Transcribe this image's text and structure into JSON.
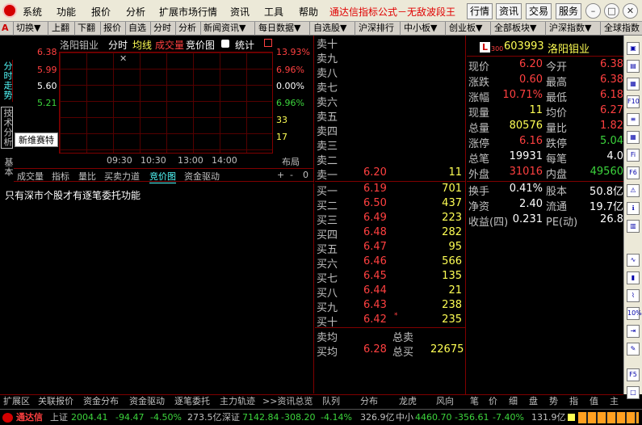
{
  "menubar": {
    "items": [
      "系统",
      "功能",
      "报价",
      "分析",
      "扩展市场行情",
      "资讯",
      "工具",
      "帮助"
    ],
    "title": "通达信指标公式－无敌波段王",
    "buttons": [
      "行情",
      "资讯",
      "交易",
      "服务"
    ]
  },
  "toolbar": {
    "items": [
      "A",
      "切换▼",
      "上翻",
      "下翻",
      "报价",
      "自选",
      "分时",
      "分析",
      "新闻资讯▼",
      "每日数据▼",
      "自选股▼",
      "沪深排行",
      "中小板▼",
      "创业板▼",
      "全部板块▼",
      "沪深指数▼",
      "全球指数"
    ]
  },
  "vtabs": [
    "分时走势",
    "技术分析",
    "基本"
  ],
  "chart": {
    "stock_name": "洛阳钼业",
    "tabs": [
      "分时",
      "均线",
      "成交量",
      "竞价图",
      "统计"
    ],
    "prices_left": [
      "6.38",
      "5.99",
      "5.60",
      "5.21"
    ],
    "pct_right": [
      "13.93%",
      "6.96%",
      "0.00%",
      "6.96%"
    ],
    "vol_right": [
      "33",
      "17"
    ],
    "times": [
      "09:30",
      "10:30",
      "13:00",
      "14:00"
    ],
    "layout_label": "布局",
    "new_label": "新维赛特",
    "subtabs": [
      "成交量",
      "指标",
      "量比",
      "买卖力道",
      "竞价图",
      "资金驱动"
    ],
    "controls": [
      "+",
      "-",
      "0"
    ]
  },
  "message": "只有深市个股才有逐笔委托功能",
  "quotes": {
    "sell_empty": [
      "卖十",
      "卖九",
      "卖八",
      "卖七",
      "卖六",
      "卖五",
      "卖四",
      "卖三",
      "卖二"
    ],
    "sell1": {
      "label": "卖一",
      "price": "6.20",
      "vol": "11"
    },
    "buy": [
      {
        "label": "买一",
        "price": "6.19",
        "vol": "701"
      },
      {
        "label": "买二",
        "price": "6.50",
        "vol": "437"
      },
      {
        "label": "买三",
        "price": "6.49",
        "vol": "223"
      },
      {
        "label": "买四",
        "price": "6.48",
        "vol": "282"
      },
      {
        "label": "买五",
        "price": "6.47",
        "vol": "95"
      },
      {
        "label": "买六",
        "price": "6.46",
        "vol": "566"
      },
      {
        "label": "买七",
        "price": "6.45",
        "vol": "135"
      },
      {
        "label": "买八",
        "price": "6.44",
        "vol": "21"
      },
      {
        "label": "买九",
        "price": "6.43",
        "vol": "238"
      },
      {
        "label": "买十",
        "price": "6.42",
        "vol": "235",
        "mark": "*"
      }
    ],
    "sell_avg_label": "卖均",
    "sell_total_label": "总卖",
    "buy_avg_label": "买均",
    "buy_avg": "6.28",
    "buy_total_label": "总买",
    "buy_total": "22675"
  },
  "stockinfo": {
    "badge": "L",
    "market": "300",
    "code": "603993",
    "name": "洛阳钼业",
    "rows": [
      [
        [
          "现价",
          "6.20",
          "red"
        ],
        [
          "今开",
          "6.38",
          "red"
        ]
      ],
      [
        [
          "涨跌",
          "0.60",
          "red"
        ],
        [
          "最高",
          "6.38",
          "red"
        ]
      ],
      [
        [
          "涨幅",
          "10.71%",
          "red"
        ],
        [
          "最低",
          "6.18",
          "red"
        ]
      ],
      [
        [
          "现量",
          "11",
          "yellow"
        ],
        [
          "均价",
          "6.27",
          "red"
        ]
      ],
      [
        [
          "总量",
          "80576",
          "yellow"
        ],
        [
          "量比",
          "1.82",
          "red"
        ]
      ],
      [
        [
          "涨停",
          "6.16",
          "red"
        ],
        [
          "跌停",
          "5.04",
          "green"
        ]
      ],
      [
        [
          "总笔",
          "19931",
          "white"
        ],
        [
          "每笔",
          "4.0",
          "white"
        ]
      ],
      [
        [
          "外盘",
          "31016",
          "red"
        ],
        [
          "内盘",
          "49560",
          "green"
        ]
      ]
    ],
    "rows2": [
      [
        [
          "换手",
          "0.41%",
          "white"
        ],
        [
          "股本",
          "50.8亿",
          "white"
        ]
      ],
      [
        [
          "净资",
          "2.40",
          "white"
        ],
        [
          "流通",
          "19.7亿",
          "white"
        ]
      ],
      [
        [
          "收益(四)",
          "0.231",
          "white"
        ],
        [
          "PE(动)",
          "26.8",
          "white"
        ]
      ]
    ]
  },
  "bottom_tabs": [
    "扩展区",
    "关联报价",
    "资金分布",
    "资金驱动",
    "逐笔委托",
    "主力轨迹",
    ">>资讯总览",
    "队列",
    "分布",
    "龙虎",
    "风向",
    "笔",
    "价",
    "细",
    "盘",
    "势",
    "指",
    "值",
    "主"
  ],
  "status": {
    "brand": "通达信",
    "sh_label": "上证",
    "sh_index": "2004.41",
    "sh_chg": "-94.47",
    "sh_pct": "-4.50%",
    "sh_amt": "273.5亿",
    "sz_label": "深证",
    "sz_index": "7142.84",
    "sz_chg": "-308.20",
    "sz_pct": "-4.14%",
    "sz_amt": "326.9亿",
    "sme_label": "中小",
    "sme_index": "4460.70",
    "sme_chg": "-356.61",
    "sme_pct": "-7.40%",
    "sme_amt": "131.9亿"
  },
  "colors": {
    "up": "#ff4040",
    "down": "#3cd43c",
    "volume": "#ffff54",
    "border": "#800000"
  }
}
